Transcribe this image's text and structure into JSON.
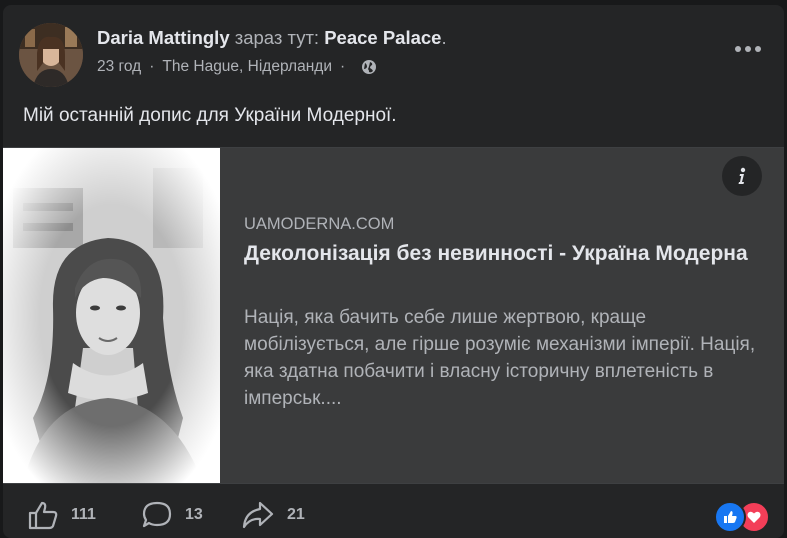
{
  "post": {
    "author": "Daria Mattingly",
    "at_text": "зараз тут:",
    "place": "Peace Palace",
    "place_end": ".",
    "time": "23 год",
    "location": "The Hague, Нідерланди",
    "separator": "·",
    "text": "Мій останній допис для України Модерної."
  },
  "link": {
    "domain": "UAMODERNA.COM",
    "title": "Деколонізація без невинності - Україна Модерна",
    "description": "Нація, яка бачить себе лише жертвою, краще мобілізується, але гірше розуміє механізми імперії. Нація, яка здатна побачити і власну історичну вплетеність в імперськ...."
  },
  "actions": {
    "likes": "111",
    "comments": "13",
    "shares": "21"
  },
  "icons": {
    "more": "more-horizontal-icon",
    "globe": "globe-icon",
    "info": "info-icon",
    "like": "like-icon",
    "comment": "comment-icon",
    "share": "share-icon",
    "like_reaction": "like-reaction-icon",
    "love_reaction": "love-reaction-icon"
  },
  "colors": {
    "card_bg": "#242526",
    "preview_bg": "#3a3b3c",
    "text_primary": "#e4e6eb",
    "text_secondary": "#b0b3b8",
    "like_blue": "#1877f2",
    "love_red": "#f33e58"
  }
}
